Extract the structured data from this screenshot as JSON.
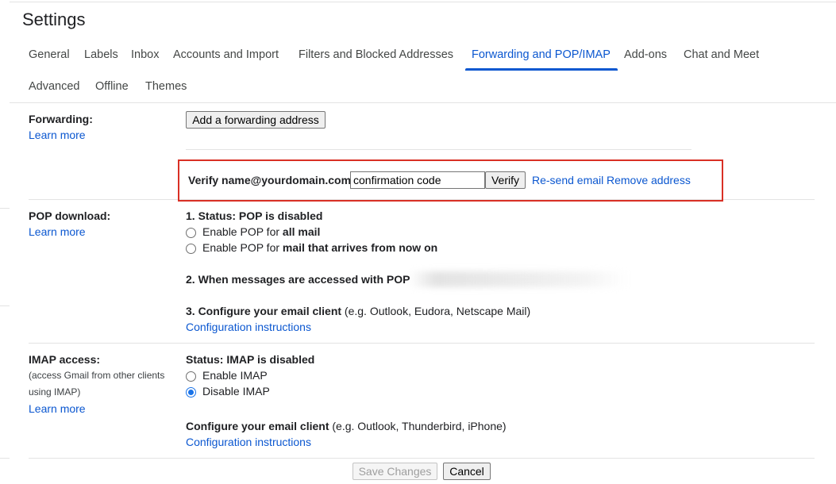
{
  "page": {
    "title": "Settings"
  },
  "tabs": [
    {
      "label": "General"
    },
    {
      "label": "Labels"
    },
    {
      "label": "Inbox"
    },
    {
      "label": "Accounts and Import"
    },
    {
      "label": "Filters and Blocked Addresses"
    },
    {
      "label": "Forwarding and POP/IMAP",
      "active": true
    },
    {
      "label": "Add-ons"
    },
    {
      "label": "Chat and Meet"
    },
    {
      "label": "Advanced"
    },
    {
      "label": "Offline"
    },
    {
      "label": "Themes"
    }
  ],
  "forwarding": {
    "label": "Forwarding:",
    "learn_more": "Learn more",
    "add_button": "Add a forwarding address",
    "verify_label": "Verify name@yourdomain.com",
    "code_value": "confirmation code",
    "verify_button": "Verify",
    "resend_link": "Re-send email",
    "remove_link": "Remove address"
  },
  "pop": {
    "label": "POP download:",
    "learn_more": "Learn more",
    "status": "1. Status: POP is disabled",
    "option_all_prefix": "Enable POP for ",
    "option_all_bold": "all mail",
    "option_now_prefix": "Enable POP for ",
    "option_now_bold": "mail that arrives from now on",
    "accessed_label": "2. When messages are accessed with POP",
    "configure_bold": "3. Configure your email client",
    "configure_rest": " (e.g. Outlook, Eudora, Netscape Mail)",
    "instructions_link": "Configuration instructions"
  },
  "imap": {
    "label": "IMAP access:",
    "sublabel": "(access Gmail from other clients using IMAP)",
    "learn_more": "Learn more",
    "status": "Status: IMAP is disabled",
    "enable_label": "Enable IMAP",
    "disable_label": "Disable IMAP",
    "selected": "disable",
    "configure_bold": "Configure your email client",
    "configure_rest": " (e.g. Outlook, Thunderbird, iPhone)",
    "instructions_link": "Configuration instructions"
  },
  "footer": {
    "save_button": "Save Changes",
    "cancel_button": "Cancel"
  },
  "colors": {
    "accent": "#0b57d0",
    "highlight_border": "#d93025",
    "radio_selected": "#1a73e8"
  }
}
